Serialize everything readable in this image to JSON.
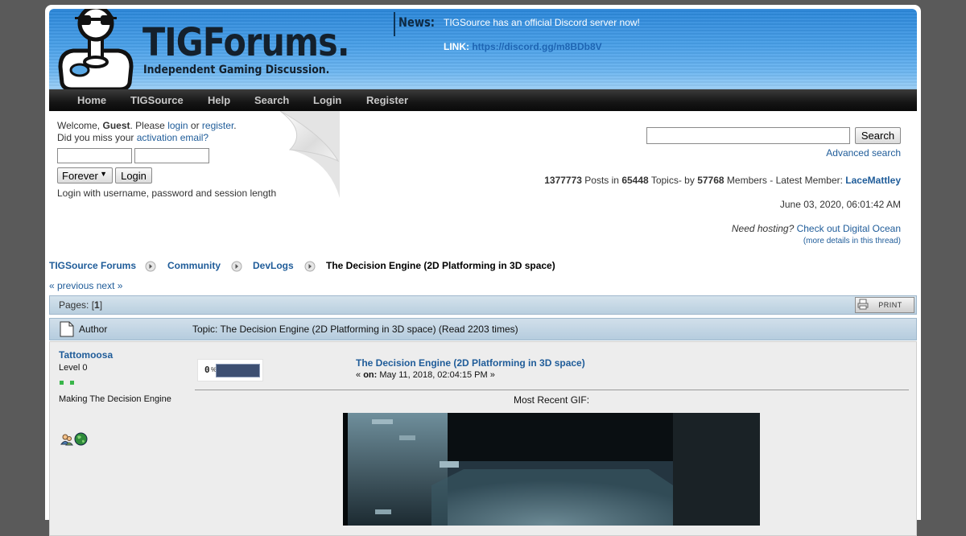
{
  "header": {
    "logo_title": "TIGForums.",
    "logo_subtitle": "Independent Gaming Discussion.",
    "news_label": "News:",
    "news_text": "TIGSource has an official Discord server now!",
    "news_link_label": "LINK:",
    "news_link_url": "https://discord.gg/m8BDb8V"
  },
  "nav": [
    "Home",
    "TIGSource",
    "Help",
    "Search",
    "Login",
    "Register"
  ],
  "user": {
    "welcome": "Welcome,",
    "guest": "Guest",
    "please": ". Please",
    "login": "login",
    "or": "or",
    "register": "register",
    "missed": "Did you miss your",
    "activation": "activation email?",
    "session_value": "Forever",
    "login_button": "Login",
    "hint": "Login with username, password and session length"
  },
  "search": {
    "button": "Search",
    "advanced": "Advanced search"
  },
  "stats": {
    "posts": "1377773",
    "posts_label": "Posts in",
    "topics": "65448",
    "topics_label": "Topics- by",
    "members": "57768",
    "members_label": "Members - Latest Member:",
    "latest_member": "LaceMattley",
    "date": "June 03, 2020, 06:01:42 AM",
    "hosting_q": "Need hosting?",
    "hosting_link": "Check out Digital Ocean",
    "hosting_more": "(more details in this thread)"
  },
  "breadcrumb": [
    "TIGSource Forums",
    "Community",
    "DevLogs",
    "The Decision Engine (2D Platforming in 3D space)"
  ],
  "prevnext": {
    "prev": "« previous",
    "next": "next »"
  },
  "pages": {
    "label": "Pages: [",
    "current": "1",
    "close": "]",
    "print": "PRINT"
  },
  "topic_bar": {
    "author": "Author",
    "topic": "Topic: The Decision Engine (2D Platforming in 3D space)  (Read 2203 times)"
  },
  "post": {
    "author": "Tattomoosa",
    "rank": "Level 0",
    "pips": 2,
    "personal": "Making The Decision Engine",
    "progress_text": "0",
    "progress_unit": "%",
    "progress_percent": 0,
    "title": "The Decision Engine (2D Platforming in 3D space)",
    "on_prefix": "«",
    "on_label": "on:",
    "date": "May 11, 2018, 02:04:15 PM »",
    "body": "Most Recent GIF:"
  },
  "colors": {
    "link": "#1f5c99",
    "header_blue": "#2a86d9",
    "nav_dark": "#151515"
  }
}
